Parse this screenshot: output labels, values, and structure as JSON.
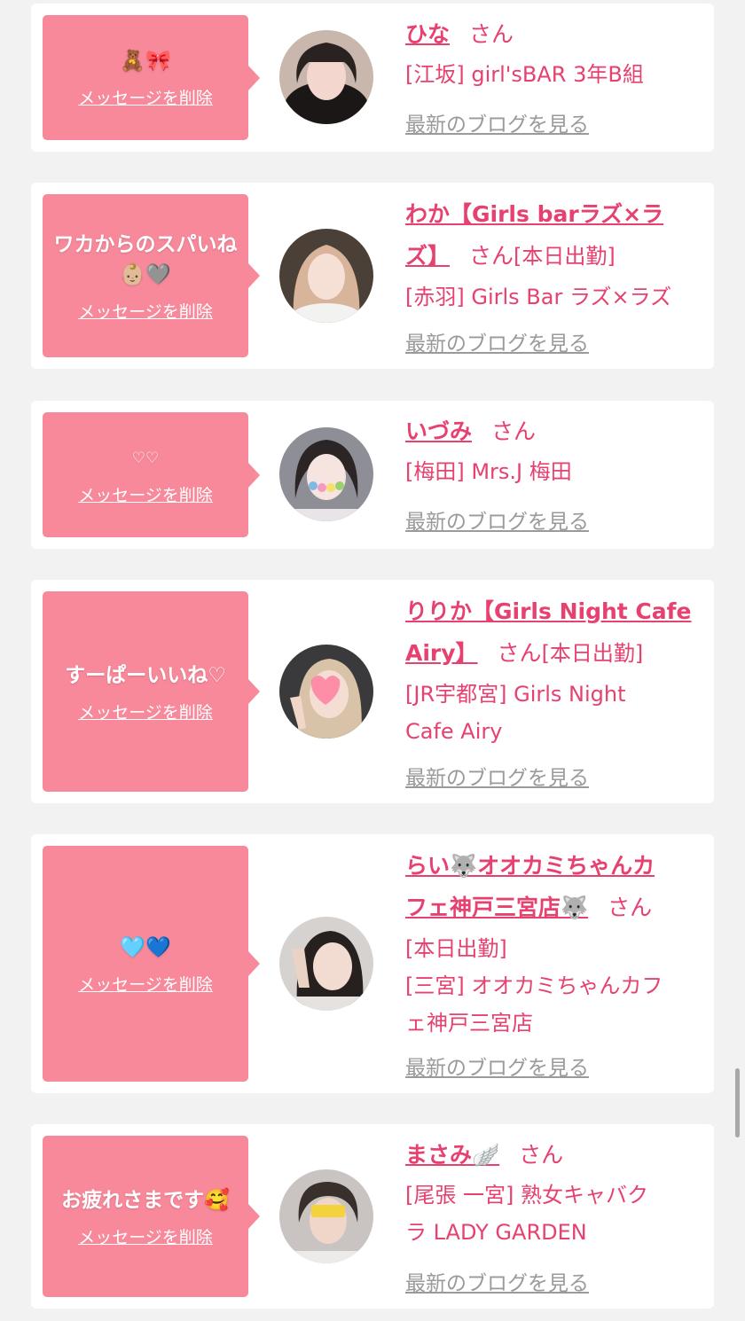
{
  "delete_label": "メッセージを削除",
  "blog_label": "最新のブログを見る",
  "san_label": "さん",
  "entries": [
    {
      "message": "🧸🎀",
      "name": "ひな",
      "status": "",
      "shop": "[江坂] girl'sBAR 3年B組"
    },
    {
      "message": "ワカからのスパいね👶🏼🩶",
      "name_line1": "わか【Girls barラズ×ラ",
      "name_line2": "ズ】",
      "status": "[本日出勤]",
      "shop": "[赤羽] Girls Bar ラズ×ラズ"
    },
    {
      "message": "♡♡",
      "name": "いづみ",
      "status": "",
      "shop": "[梅田] Mrs.J 梅田"
    },
    {
      "message": "すーぱーいいね♡",
      "name_line1": "りりか【Girls Night Cafe",
      "name_line2": "Airy】",
      "status": "[本日出勤]",
      "shop_line1": "[JR宇都宮] Girls Night",
      "shop_line2": "Cafe Airy"
    },
    {
      "message": "🩵💙",
      "name_line1": "らい🐺オオカミちゃんカ",
      "name_line2": "フェ神戸三宮店🐺",
      "status": "[本日出勤]",
      "shop_line1": "[三宮] オオカミちゃんカフ",
      "shop_line2": "ェ神戸三宮店"
    },
    {
      "message": "お疲れさまです🥰",
      "name": "まさみ🪽",
      "status": "",
      "shop_line1": "[尾張 一宮] 熟女キャバク",
      "shop_line2": "ラ LADY GARDEN"
    }
  ],
  "colors": {
    "accent": "#e6416f",
    "bubble": "#f7899b",
    "background": "#f2f2f2"
  }
}
